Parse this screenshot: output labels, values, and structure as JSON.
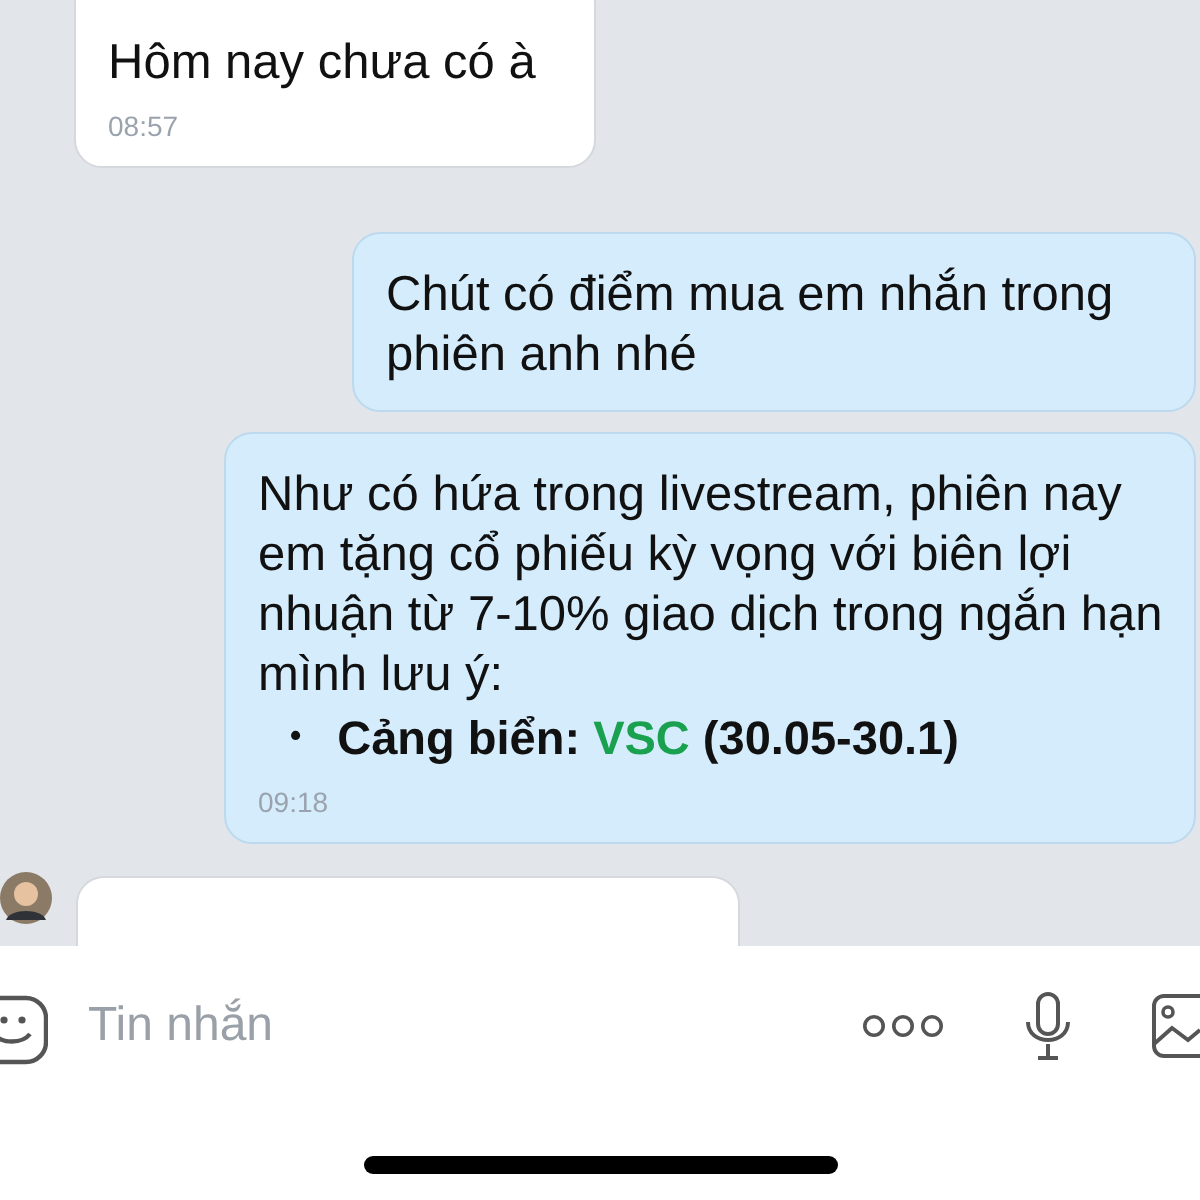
{
  "messages": [
    {
      "kind": "incoming",
      "text": "Hôm nay chưa có à",
      "time": "08:57"
    },
    {
      "kind": "outgoing",
      "text": "Chút có điểm mua em nhắn trong phiên anh nhé"
    },
    {
      "kind": "outgoing",
      "text": "Như có hứa trong livestream, phiên nay em tặng cổ phiếu kỳ vọng với biên lợi nhuận từ 7-10% giao dịch trong ngắn hạn mình lưu ý:",
      "bullets": [
        {
          "marker": "•",
          "label": "Cảng biển:",
          "ticker": "VSC",
          "range": "(30.05-30.1)"
        }
      ],
      "time": "09:18"
    },
    {
      "kind": "incoming",
      "avatar": true
    }
  ],
  "composer": {
    "placeholder": "Tin nhắn"
  }
}
